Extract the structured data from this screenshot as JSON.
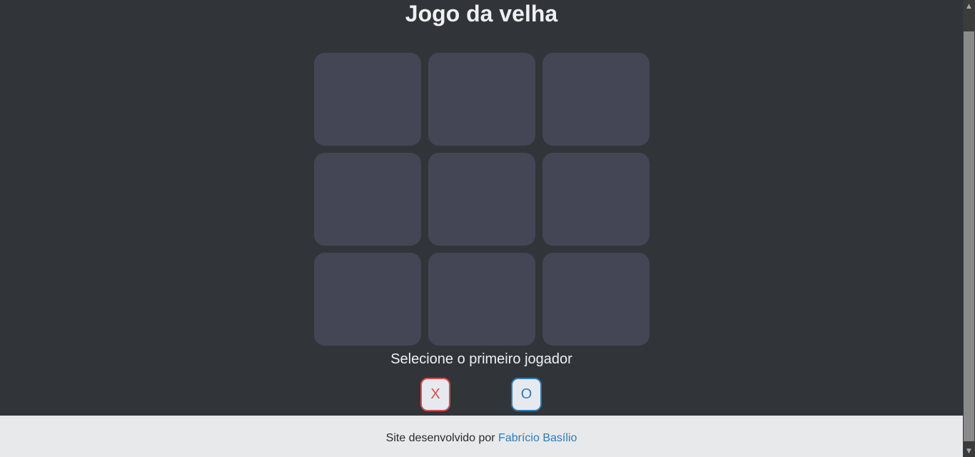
{
  "title": "Jogo da velha",
  "board": {
    "cells": [
      "",
      "",
      "",
      "",
      "",
      "",
      "",
      "",
      ""
    ]
  },
  "prompt": "Selecione o primeiro jogador",
  "choices": {
    "x_label": "X",
    "o_label": "O"
  },
  "footer": {
    "text": "Site desenvolvido por",
    "author": "Fabrício Basílio"
  },
  "colors": {
    "background": "#313539",
    "cell": "#454655",
    "x_accent": "#d94b4b",
    "o_accent": "#2f7bb8",
    "footer_bg": "#e8e9eb"
  }
}
